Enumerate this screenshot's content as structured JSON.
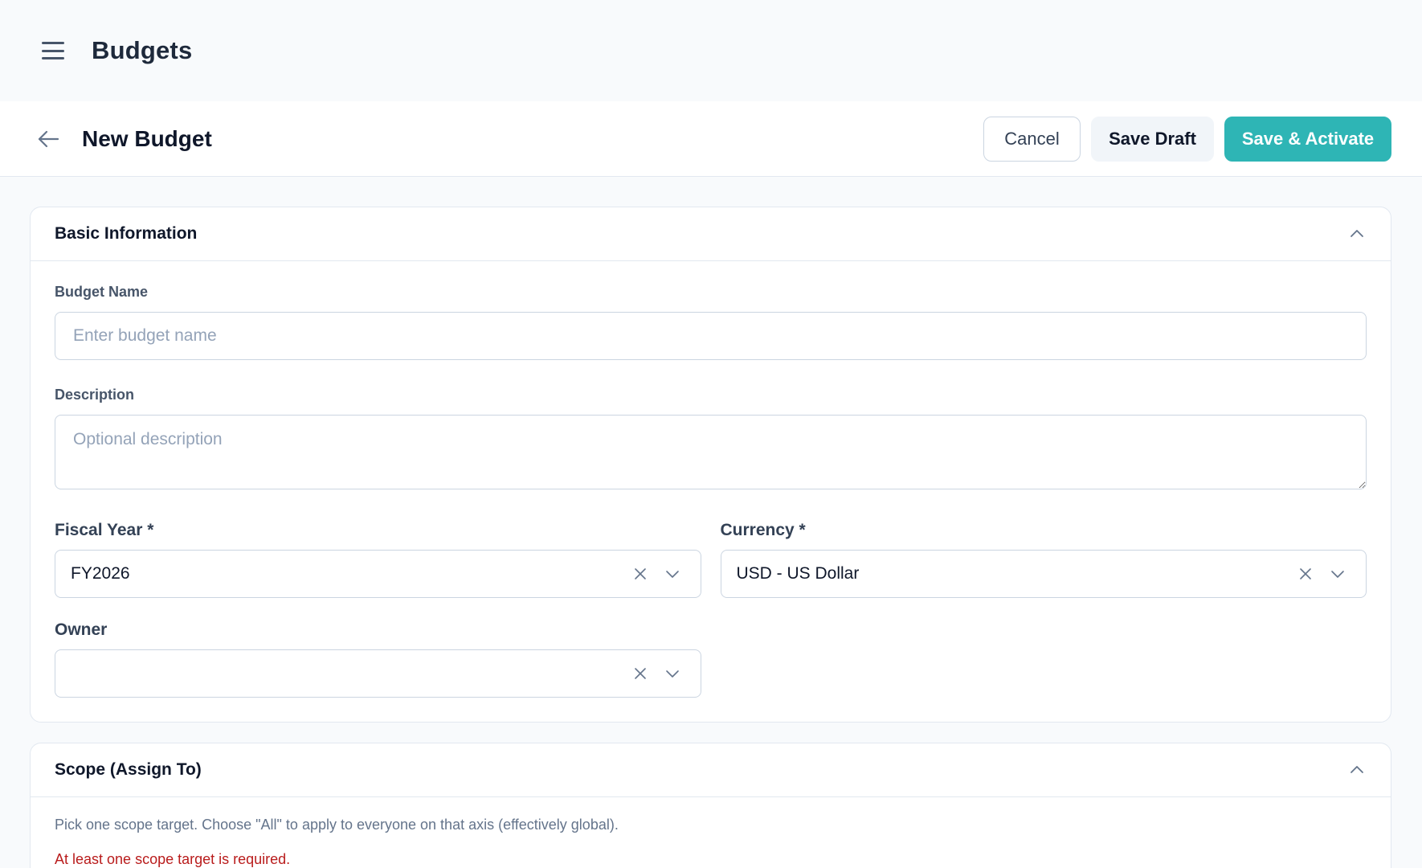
{
  "app": {
    "title": "Budgets"
  },
  "header": {
    "page_title": "New Budget",
    "cancel_label": "Cancel",
    "save_draft_label": "Save Draft",
    "save_activate_label": "Save & Activate",
    "accent_color": "#2eb5b5"
  },
  "basic_info": {
    "title": "Basic Information",
    "budget_name": {
      "label": "Budget Name",
      "placeholder": "Enter budget name",
      "value": ""
    },
    "description": {
      "label": "Description",
      "placeholder": "Optional description",
      "value": ""
    },
    "fiscal_year": {
      "label": "Fiscal Year *",
      "value": "FY2026"
    },
    "currency": {
      "label": "Currency *",
      "value": "USD - US Dollar"
    },
    "owner": {
      "label": "Owner",
      "value": ""
    }
  },
  "scope": {
    "title": "Scope (Assign To)",
    "help": "Pick one scope target. Choose \"All\" to apply to everyone on that axis (effectively global).",
    "error": "At least one scope target is required.",
    "error_color": "#b91c1c"
  },
  "icons": {
    "menu": "hamburger-icon",
    "back": "arrow-left-icon",
    "collapse": "chevron-up-icon",
    "clear": "close-icon",
    "dropdown": "chevron-down-icon"
  }
}
